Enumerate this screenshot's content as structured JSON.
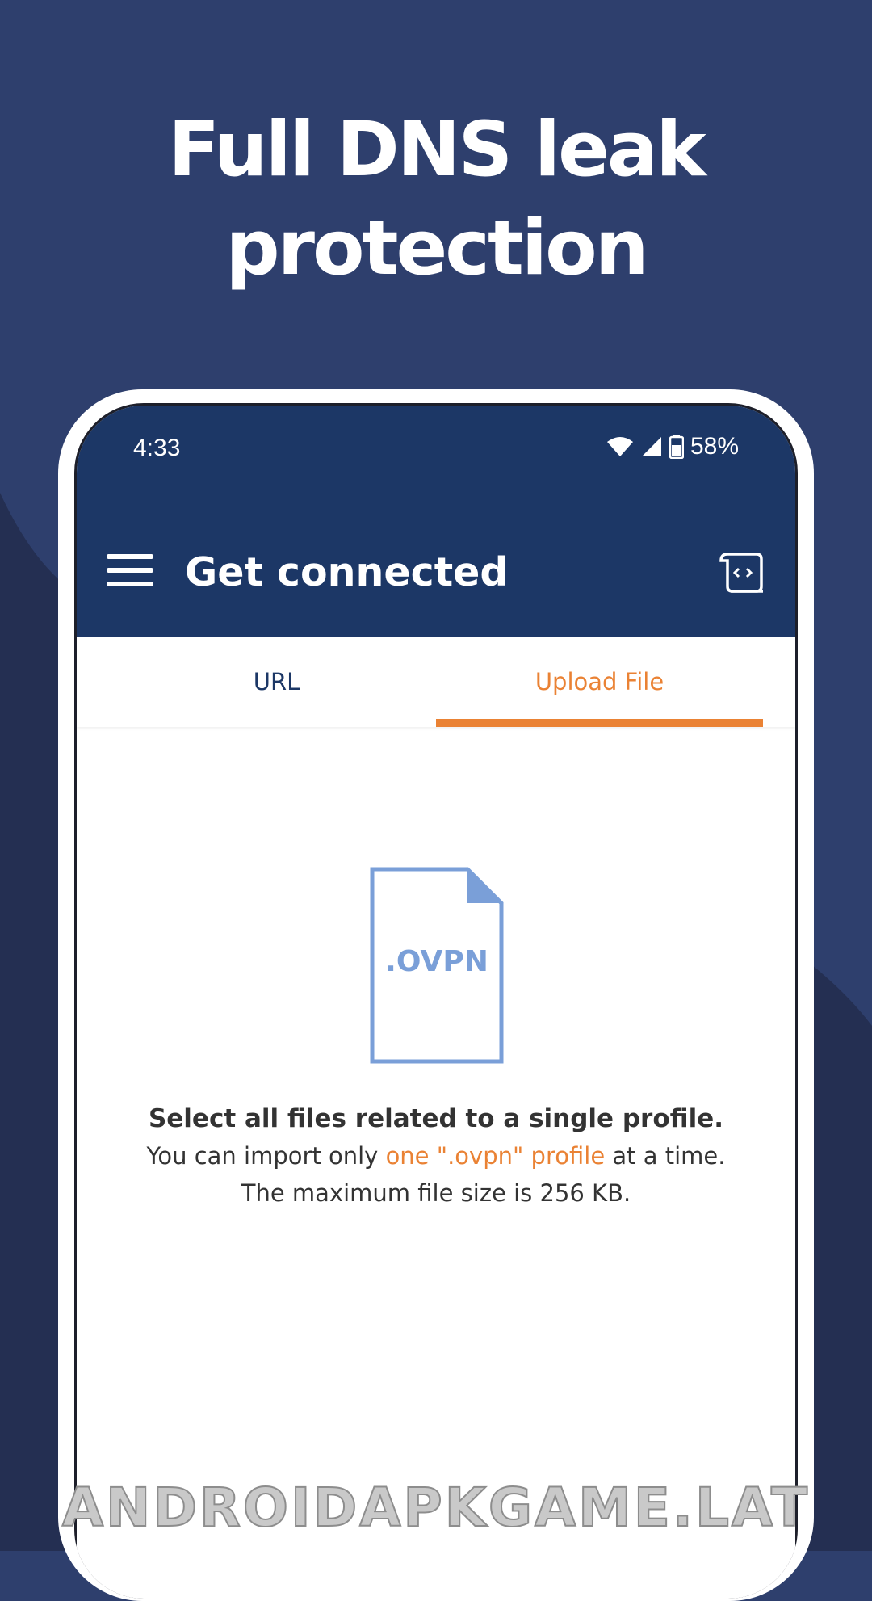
{
  "headline": {
    "line1": "Full DNS leak",
    "line2": "protection"
  },
  "status_bar": {
    "time": "4:33",
    "battery": "58%",
    "icons": [
      "wifi-icon",
      "cell-signal-icon",
      "battery-icon"
    ]
  },
  "app_bar": {
    "title": "Get connected",
    "menu_icon": "hamburger-menu-icon",
    "action_icon": "logs-scroll-icon"
  },
  "tabs": [
    {
      "label": "URL",
      "selected": false
    },
    {
      "label": "Upload File",
      "selected": true
    }
  ],
  "upload": {
    "file_icon_label": ".OVPN",
    "title": "Select all files related to a single profile.",
    "line2_prefix": "You can import only ",
    "line2_link": "one \".ovpn\" profile",
    "line2_suffix": " at a time.",
    "line3": "The maximum file size is 256 KB."
  },
  "watermark": "ANDROIDAPKGAME.LAT",
  "colors": {
    "background": "#2e3f6d",
    "background_dark": "#242f52",
    "app_bar": "#1c3766",
    "accent": "#ea8234",
    "file_icon": "#7a9fd8"
  }
}
